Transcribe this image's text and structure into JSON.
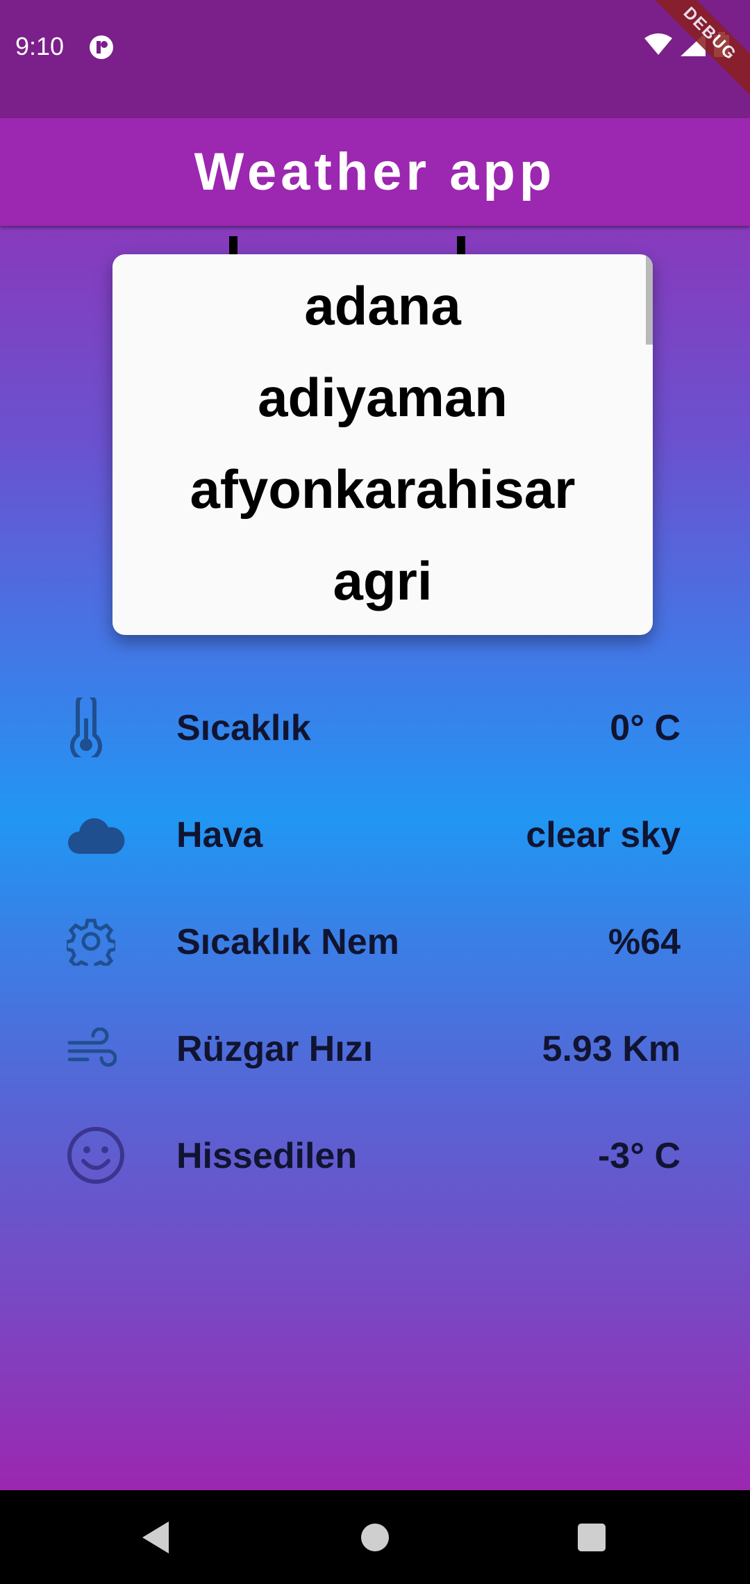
{
  "status_bar": {
    "time": "9:10",
    "icons": [
      "notification-icon",
      "wifi-icon",
      "signal-icon",
      "battery-icon"
    ]
  },
  "debug_banner": "DEBUG",
  "app_bar": {
    "title": "Weather app"
  },
  "dropdown": {
    "options": [
      "adana",
      "adiyaman",
      "afyonkarahisar",
      "agri"
    ]
  },
  "weather_info": {
    "rows": [
      {
        "icon": "thermometer-icon",
        "label": "Sıcaklık",
        "value": "0° C"
      },
      {
        "icon": "cloud-icon",
        "label": "Hava",
        "value": "clear sky"
      },
      {
        "icon": "gear-icon",
        "label": "Sıcaklık Nem",
        "value": "%64"
      },
      {
        "icon": "wind-icon",
        "label": "Rüzgar Hızı",
        "value": "5.93 Km"
      },
      {
        "icon": "smiley-icon",
        "label": "Hissedilen",
        "value": "-3° C"
      }
    ]
  },
  "nav_bar": {
    "buttons": [
      "back-icon",
      "home-icon",
      "recents-icon"
    ]
  },
  "colors": {
    "app_bar": "#9c27b0",
    "status_bar": "#7b1f8a",
    "gradient_mid": "#2196f3",
    "icon_color": "#1f4f8f",
    "text_dark": "#111430"
  }
}
